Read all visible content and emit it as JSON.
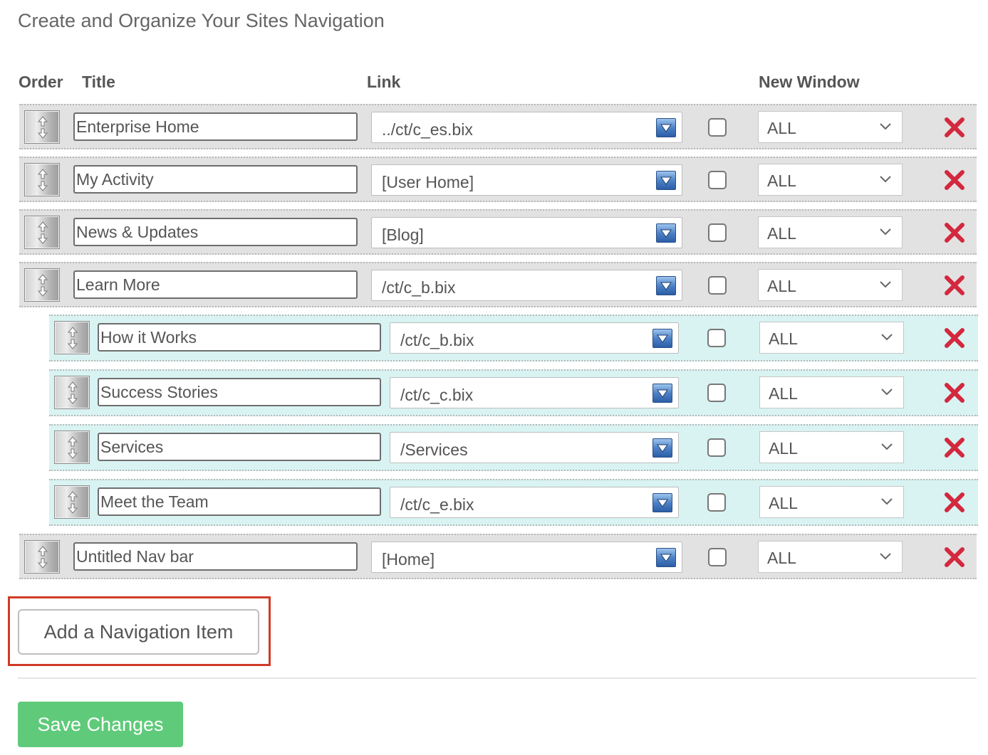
{
  "page": {
    "title": "Create and Organize Your Sites Navigation"
  },
  "table_headers": {
    "order": "Order",
    "title": "Title",
    "link": "Link",
    "new_window": "New Window"
  },
  "nav_items": [
    {
      "level": "top",
      "title": "Enterprise Home",
      "link": "../ct/c_es.bix",
      "new_window": false,
      "target": "ALL"
    },
    {
      "level": "top",
      "title": "My Activity",
      "link": "[User Home]",
      "new_window": false,
      "target": "ALL"
    },
    {
      "level": "top",
      "title": "News & Updates",
      "link": "[Blog]",
      "new_window": false,
      "target": "ALL"
    },
    {
      "level": "top",
      "title": "Learn More",
      "link": "/ct/c_b.bix",
      "new_window": false,
      "target": "ALL"
    },
    {
      "level": "child",
      "title": "How it Works",
      "link": "/ct/c_b.bix",
      "new_window": false,
      "target": "ALL"
    },
    {
      "level": "child",
      "title": "Success Stories",
      "link": "/ct/c_c.bix",
      "new_window": false,
      "target": "ALL"
    },
    {
      "level": "child",
      "title": "Services",
      "link": "/Services",
      "new_window": false,
      "target": "ALL"
    },
    {
      "level": "child",
      "title": "Meet the Team",
      "link": "/ct/c_e.bix",
      "new_window": false,
      "target": "ALL"
    },
    {
      "level": "top",
      "title": "Untitled Nav bar",
      "link": "[Home]",
      "new_window": false,
      "target": "ALL"
    }
  ],
  "icons": {
    "drag": "updown-arrows-icon",
    "link_dropdown": "triangle-down-icon",
    "target_dropdown": "chevron-down-icon",
    "delete": "red-x-icon"
  },
  "colors": {
    "top_row_bg": "#e2e2e2",
    "child_row_bg": "#d8f3f2",
    "delete": "#d3283e",
    "save_button": "#5fca7a",
    "highlight_border": "#d03a26"
  },
  "actions": {
    "add_item_label": "Add a Navigation Item",
    "save_label": "Save Changes"
  }
}
